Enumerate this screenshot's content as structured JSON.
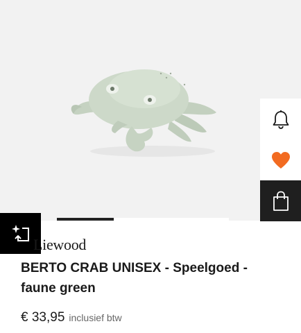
{
  "gallery": {
    "image_subject": "plush crab toy",
    "progress_fraction": 0.33
  },
  "side_actions": {
    "notify_icon": "bell-icon",
    "wishlist_icon": "heart-icon",
    "cart_icon": "shopping-bag-icon"
  },
  "compare_icon": "sparkle-compare-icon",
  "product": {
    "brand": "Liewood",
    "title": "BERTO CRAB UNISEX - Speelgoed - faune green",
    "price": "€ 33,95",
    "price_note": "inclusief btw"
  },
  "colors": {
    "wishlist_heart": "#f26b21",
    "cart_button_bg": "#1f1f1f",
    "gallery_bg": "#f2f2f2"
  }
}
